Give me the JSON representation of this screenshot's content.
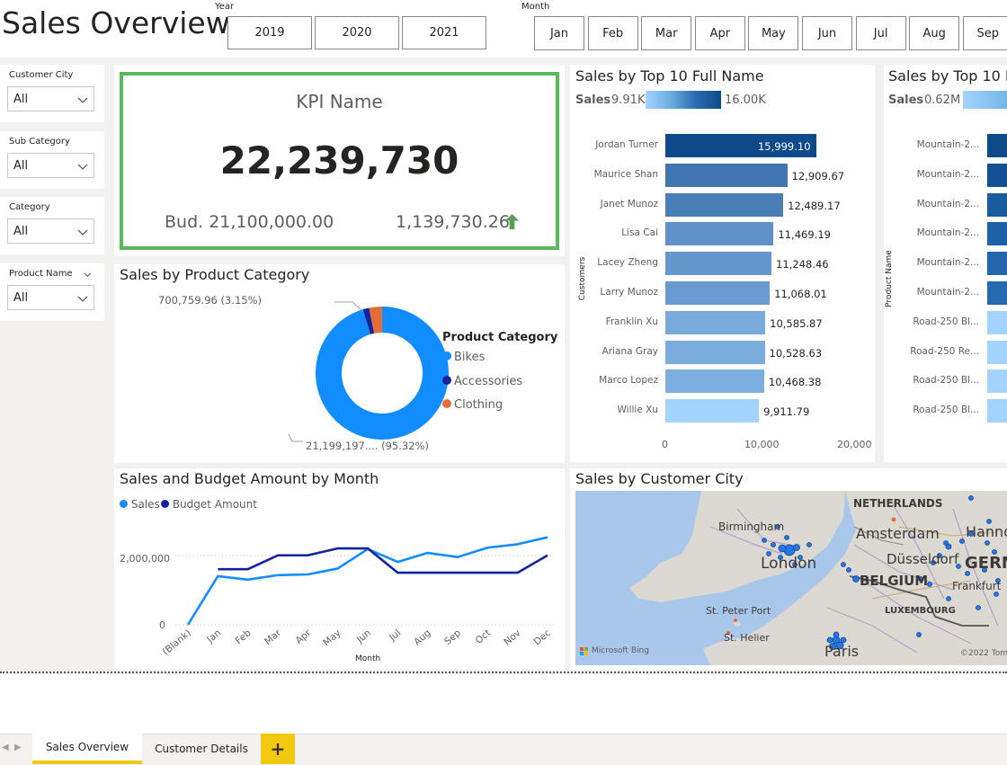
{
  "header": {
    "title": "Sales Overview"
  },
  "year_slicer": {
    "label": "Year",
    "options": [
      "2019",
      "2020",
      "2021"
    ]
  },
  "month_slicer": {
    "label": "Month",
    "options": [
      "Jan",
      "Feb",
      "Mar",
      "Apr",
      "May",
      "Jun",
      "Jul",
      "Aug",
      "Sep"
    ]
  },
  "filters": [
    {
      "label": "Customer City",
      "value": "All"
    },
    {
      "label": "Sub Category",
      "value": "All"
    },
    {
      "label": "Category",
      "value": "All"
    },
    {
      "label": "Product Name",
      "value": "All"
    }
  ],
  "kpi": {
    "name": "KPI Name",
    "value": "22,239,730",
    "budget": "Bud. 21,100,000.00",
    "variance": "1,139,730.26",
    "border_color": "#5cb85c",
    "arrow_color": "#5aa05a"
  },
  "donut": {
    "title": "Sales by Product Category",
    "legend_title": "Product Category",
    "label_top": "700,759.96 (3.15%)",
    "label_bottom": "21,199,197.... (95.32%)",
    "slices": [
      {
        "name": "Bikes",
        "share": 95.32,
        "color": "#118dff"
      },
      {
        "name": "Accessories",
        "share": 1.53,
        "color": "#12239e"
      },
      {
        "name": "Clothing",
        "share": 3.15,
        "color": "#e66c37"
      }
    ]
  },
  "top10_names": {
    "title": "Sales by Top 10 Full Name",
    "legend_label": "Sales",
    "legend_min": "9.91K",
    "legend_max": "16.00K",
    "y_axis_title": "Customers",
    "x_ticks": [
      "0",
      "10,000",
      "20,000"
    ],
    "chart_data": {
      "type": "bar",
      "categories": [
        "Jordan Turner",
        "Maurice Shan",
        "Janet Munoz",
        "Lisa Cai",
        "Lacey Zheng",
        "Larry Munoz",
        "Franklin Xu",
        "Ariana Gray",
        "Marco Lopez",
        "Willie Xu"
      ],
      "values": [
        15999.1,
        12909.67,
        12489.17,
        11469.19,
        11248.46,
        11068.01,
        10585.87,
        10528.63,
        10468.38,
        9911.79
      ],
      "labels": [
        "15,999.10",
        "12,909.67",
        "12,489.17",
        "11,469.19",
        "11,248.46",
        "11,068.01",
        "10,585.87",
        "10,528.63",
        "10,468.38",
        "9,911.79"
      ],
      "xlim": [
        0,
        20000
      ]
    }
  },
  "top10_products": {
    "title": "Sales by Top 10 P",
    "legend_label": "Sales",
    "legend_min": "0.62M",
    "y_axis_title": "Product Name",
    "categories": [
      "Mountain-2...",
      "Mountain-2...",
      "Mountain-2...",
      "Mountain-2...",
      "Mountain-2...",
      "Mountain-2...",
      "Road-250 Bl...",
      "Road-250 Re...",
      "Road-250 Bl...",
      "Road-250 Bl..."
    ]
  },
  "line_chart": {
    "title": "Sales and Budget Amount by Month",
    "x_axis_title": "Month",
    "y_ticks": [
      "2,000,000",
      "0"
    ],
    "chart_data": {
      "type": "line",
      "x": [
        "(Blank)",
        "Jan",
        "Feb",
        "Mar",
        "Apr",
        "May",
        "Jun",
        "Jul",
        "Aug",
        "Sep",
        "Oct",
        "Nov",
        "Dec"
      ],
      "series": [
        {
          "name": "Sales",
          "color": "#118dff",
          "values": [
            0,
            1400000,
            1300000,
            1430000,
            1450000,
            1620000,
            2180000,
            1810000,
            2070000,
            1950000,
            2220000,
            2320000,
            2520000
          ]
        },
        {
          "name": "Budget Amount",
          "color": "#12239e",
          "values": [
            null,
            1600000,
            1600000,
            2000000,
            2000000,
            2200000,
            2200000,
            1500000,
            1500000,
            1500000,
            1500000,
            1500000,
            2000000
          ]
        }
      ],
      "ylim": [
        0,
        2900000
      ]
    }
  },
  "map": {
    "title": "Sales by Customer City",
    "labels": [
      "NETHERLANDS",
      "Amsterdam",
      "Hanno",
      "Birmingham",
      "London",
      "Düsseldorf",
      "GERM",
      "BELGIUM",
      "Frankfurt",
      "LUXEMBOURG",
      "St. Peter Port",
      "St. Helier",
      "Paris"
    ],
    "attribution": "Microsoft Bing",
    "copyright": "©2022 Tom"
  },
  "tabs": {
    "active": "Sales Overview",
    "other": "Customer Details",
    "add": "+"
  }
}
